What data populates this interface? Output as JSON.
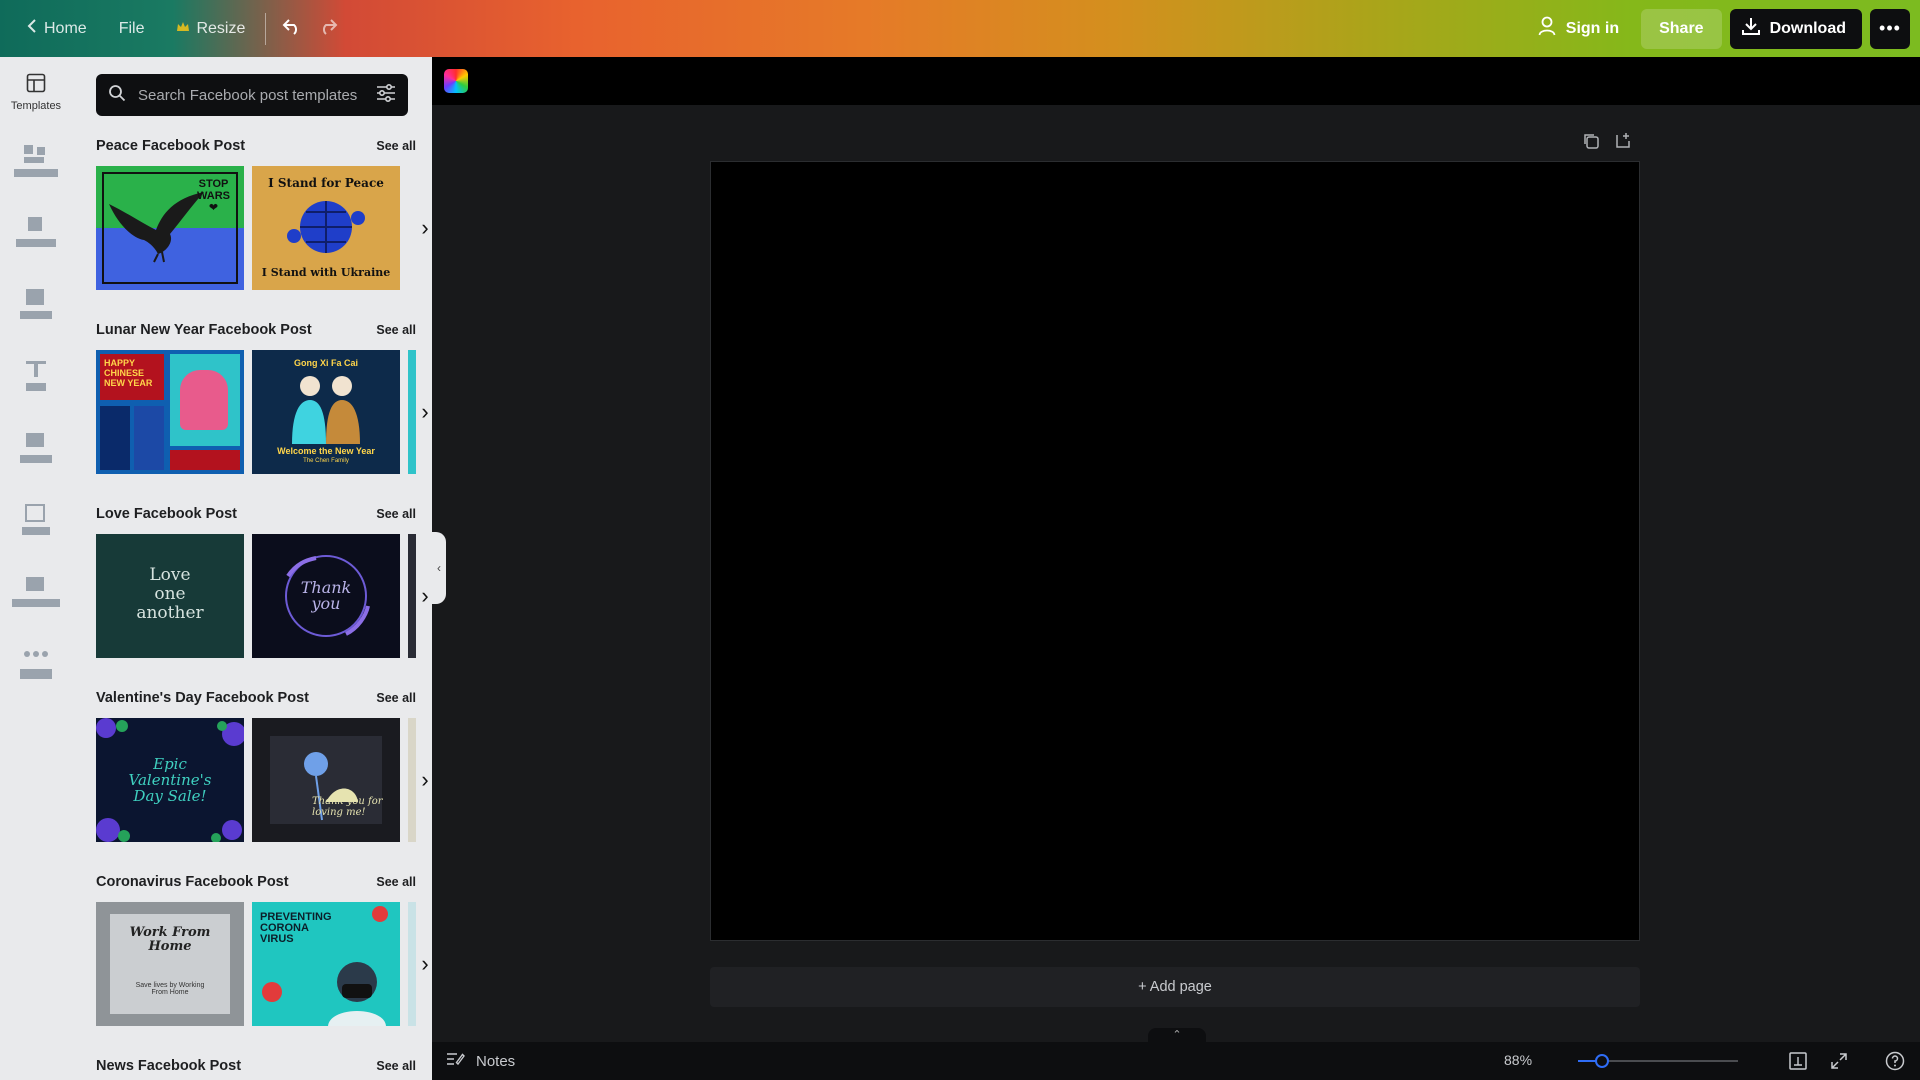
{
  "topbar": {
    "home_label": "Home",
    "file_label": "File",
    "resize_label": "Resize",
    "signin_label": "Sign in",
    "share_label": "Share",
    "download_label": "Download",
    "more_label": "•••"
  },
  "rail": {
    "items": [
      {
        "label": "Templates",
        "icon": "templates-icon"
      }
    ]
  },
  "panel": {
    "search_placeholder": "Search Facebook post templates",
    "sections": [
      {
        "title": "Peace Facebook Post",
        "see_all": "See all",
        "thumb1": {
          "line1": "STOP",
          "line2": "WARS"
        },
        "thumb2": {
          "top": "I Stand for Peace",
          "bottom": "I Stand with Ukraine"
        }
      },
      {
        "title": "Lunar New Year Facebook Post",
        "see_all": "See all",
        "thumb1": {
          "line1": "HAPPY",
          "line2": "CHINESE",
          "line3": "NEW YEAR"
        },
        "thumb2": {
          "top": "Gong Xi Fa Cai",
          "bottom": "Welcome the New Year",
          "sub": "The Chen Family"
        }
      },
      {
        "title": "Love Facebook Post",
        "see_all": "See all",
        "thumb1": {
          "line1": "Love",
          "line2": "one",
          "line3": "another"
        },
        "thumb2": {
          "line1": "Thank",
          "line2": "you"
        }
      },
      {
        "title": "Valentine's Day Facebook Post",
        "see_all": "See all",
        "thumb1": {
          "line1": "Epic",
          "line2": "Valentine's",
          "line3": "Day Sale!"
        },
        "thumb2": {
          "line1": "Thank you for",
          "line2": "loving me!"
        }
      },
      {
        "title": "Coronavirus Facebook Post",
        "see_all": "See all",
        "thumb1": {
          "line1": "Work From",
          "line2": "Home",
          "sub": "Save lives by Working From Home"
        },
        "thumb2": {
          "line1": "PREVENTING",
          "line2": "CORONA",
          "line3": "VIRUS"
        }
      },
      {
        "title": "News Facebook Post",
        "see_all": "See all"
      }
    ]
  },
  "editor": {
    "add_page_label": "+ Add page",
    "notes_label": "Notes",
    "zoom_label": "88%",
    "zoom_fraction": 0.15
  },
  "colors": {
    "accent_blue": "#2f6df6",
    "panel_bg": "#e9eaec",
    "editor_bg": "#18191b"
  }
}
